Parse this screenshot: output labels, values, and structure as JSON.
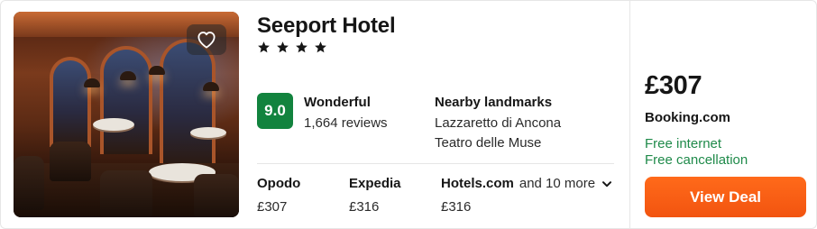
{
  "hotel": {
    "name": "Seeport Hotel",
    "star_count": 4,
    "rating_score": "9.0",
    "rating_label": "Wonderful",
    "review_count": "1,664 reviews"
  },
  "landmarks": {
    "title": "Nearby landmarks",
    "items": [
      "Lazzaretto di Ancona",
      "Teatro delle Muse"
    ]
  },
  "providers": [
    {
      "name": "Opodo",
      "price": "£307"
    },
    {
      "name": "Expedia",
      "price": "£316"
    },
    {
      "name": "Hotels.com",
      "price": "£316",
      "more": "and 10 more"
    }
  ],
  "deal": {
    "price": "£307",
    "source": "Booking.com",
    "amenities": [
      "Free internet",
      "Free cancellation"
    ],
    "button_label": "View Deal"
  },
  "colors": {
    "rating_badge": "#12833e",
    "amenity_text": "#1f8a4a",
    "deal_button": "#f25410"
  },
  "icons": {
    "favorite": "heart-outline-icon",
    "star": "star-icon",
    "expand": "chevron-down-icon"
  }
}
